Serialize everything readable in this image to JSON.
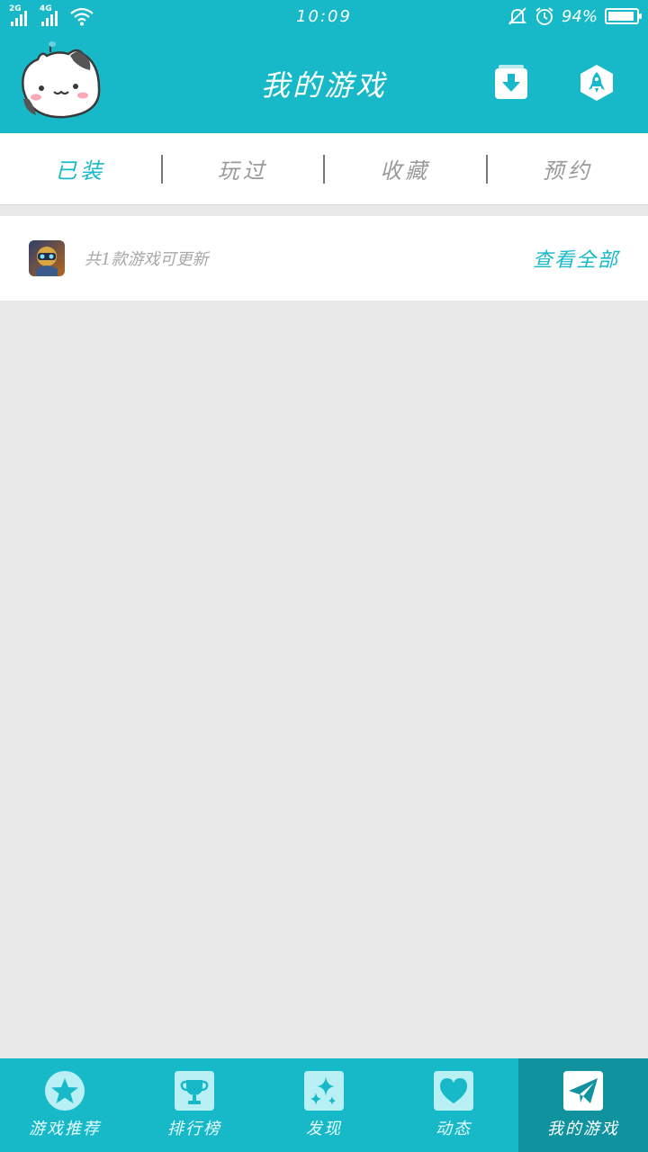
{
  "status_bar": {
    "net1": "2G",
    "net2": "4G",
    "time": "10:09",
    "battery": "94%",
    "battery_level": 0.94
  },
  "header": {
    "title": "我的游戏"
  },
  "tabs": [
    {
      "label": "已装",
      "active": true
    },
    {
      "label": "玩过",
      "active": false
    },
    {
      "label": "收藏",
      "active": false
    },
    {
      "label": "预约",
      "active": false
    }
  ],
  "updates": {
    "text": "共1款游戏可更新",
    "view_all": "查看全部"
  },
  "bottom_nav": [
    {
      "label": "游戏推荐",
      "icon": "star-icon"
    },
    {
      "label": "排行榜",
      "icon": "trophy-icon"
    },
    {
      "label": "发现",
      "icon": "sparkle-icon"
    },
    {
      "label": "动态",
      "icon": "heart-icon"
    },
    {
      "label": "我的游戏",
      "icon": "paper-plane-icon",
      "active": true
    }
  ],
  "colors": {
    "accent": "#17b9c9",
    "accent_dark": "#11939f",
    "background": "#e8e8e8"
  }
}
